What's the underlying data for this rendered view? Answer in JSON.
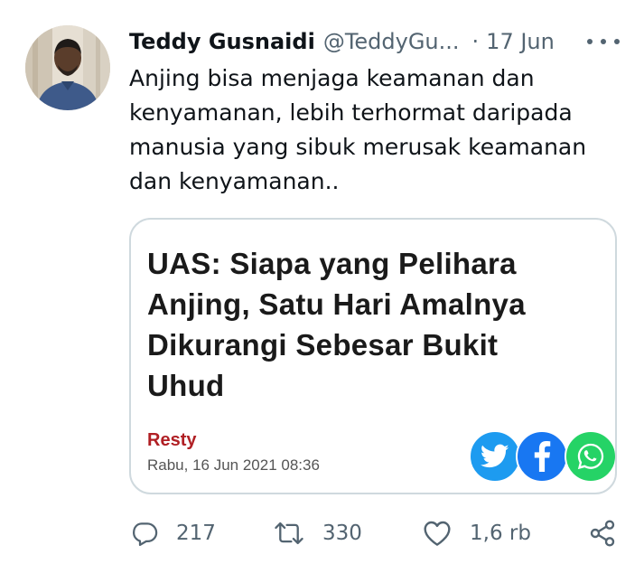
{
  "author": {
    "display_name": "Teddy Gusnaidi",
    "handle": "@TeddyGu...",
    "separator": "·",
    "date": "17 Jun"
  },
  "tweet": {
    "text": "Anjing bisa menjaga keamanan dan\nkenyamanan, lebih terhormat daripada\nmanusia yang sibuk merusak keamanan\ndan kenyamanan.."
  },
  "card": {
    "headline": "UAS: Siapa yang Pelihara Anjing, Satu Hari Amalnya Dikurangi Sebesar Bukit Uhud",
    "author": "Resty",
    "date": "Rabu, 16 Jun 2021 08:36",
    "share_icons": [
      "twitter-icon",
      "facebook-icon",
      "whatsapp-icon"
    ]
  },
  "actions": {
    "replies": "217",
    "retweets": "330",
    "likes": "1,6 rb"
  },
  "colors": {
    "text": "#0f1419",
    "secondary": "#536471",
    "card_border": "#cfd9de",
    "author_red": "#b01f24",
    "twitter_blue": "#1d9bf0",
    "facebook_blue": "#1877f2",
    "whatsapp_green": "#25d366"
  }
}
